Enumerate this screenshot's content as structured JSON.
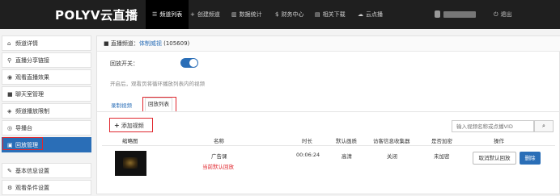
{
  "topbar": {
    "logo": "POLYV云直播",
    "nav": [
      {
        "label": "频道列表",
        "icon": "list-icon",
        "active": true
      },
      {
        "label": "创建频道",
        "icon": "plus-icon"
      },
      {
        "label": "数据统计",
        "icon": "bar-chart-icon"
      },
      {
        "label": "财务中心",
        "icon": "dollar-icon"
      },
      {
        "label": "相关下载",
        "icon": "download-icon"
      },
      {
        "label": "云点播",
        "icon": "cloud-icon"
      }
    ],
    "logout": "退出"
  },
  "sidebar": {
    "items": [
      {
        "label": "频道详情",
        "icon": "home-icon"
      },
      {
        "label": "直播分享链接",
        "icon": "link-icon"
      },
      {
        "label": "观看直播效果",
        "icon": "eye-icon"
      },
      {
        "label": "聊天室管理",
        "icon": "chat-icon"
      },
      {
        "label": "频道播放限制",
        "icon": "lock-icon"
      },
      {
        "label": "导播台",
        "icon": "broadcast-icon"
      },
      {
        "label": "回放管理",
        "icon": "film-icon",
        "active": true
      },
      {
        "label": "基本信息设置",
        "icon": "wrench-icon"
      },
      {
        "label": "观看条件设置",
        "icon": "settings-icon"
      }
    ]
  },
  "main": {
    "breadcrumb_prefix": "直播频道：",
    "channel_name": "体制威视",
    "channel_id": "(105609)",
    "toggle_label": "回放开关：",
    "toggle_on": true,
    "hint": "开启后，观看页将循环播放列表内的视频",
    "tabs": [
      {
        "label": "录制视频",
        "active": false
      },
      {
        "label": "回放列表",
        "active": true
      }
    ],
    "add_button": "添加视频",
    "search_placeholder": "输入视频名称或点播VID",
    "columns": [
      "缩略图",
      "名称",
      "时长",
      "默认画质",
      "访客信息收集器",
      "是否加密",
      "操作"
    ],
    "rows": [
      {
        "name": "广告课",
        "tag": "当前默认回放",
        "duration": "00:06:24",
        "quality": "高清",
        "collector": "关闭",
        "encrypted": "未加密",
        "actions": {
          "cancel": "取消默认回放",
          "delete": "删除"
        }
      }
    ]
  },
  "colors": {
    "accent": "#2a6eb7",
    "highlight": "#e0272e",
    "topbar": "#1f1f1f"
  }
}
